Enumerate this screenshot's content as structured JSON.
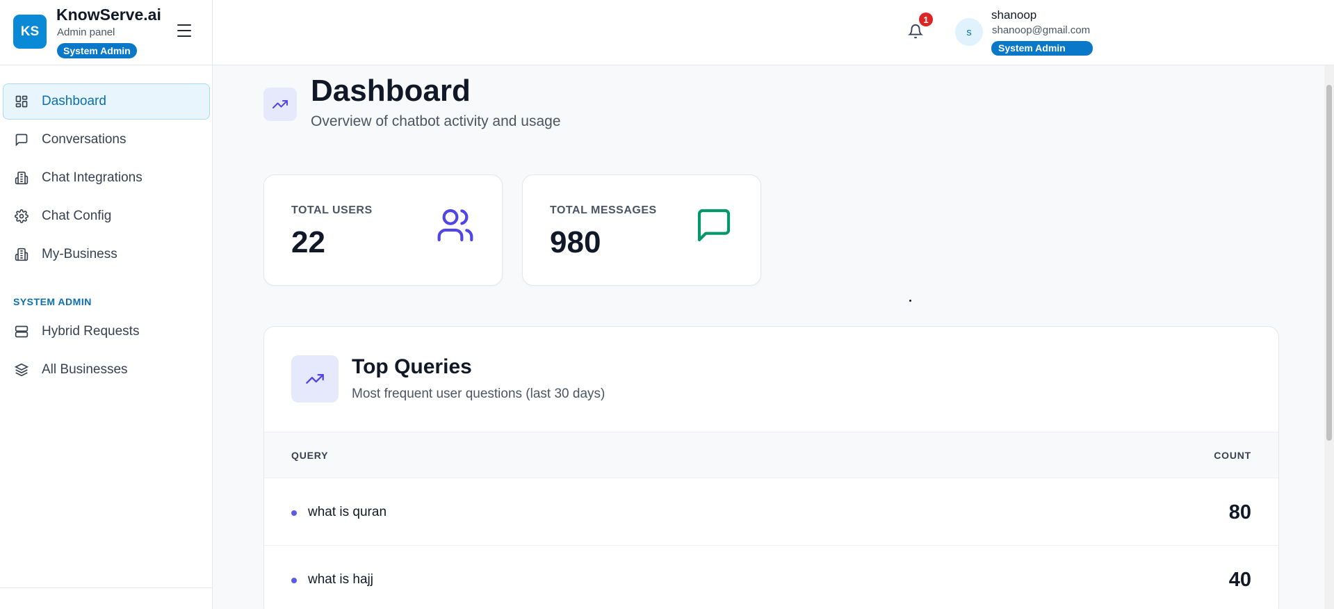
{
  "brand": {
    "logo_text": "KS",
    "name": "KnowServe.ai",
    "subtitle": "Admin panel",
    "badge": "System Admin"
  },
  "sidebar": {
    "items": [
      {
        "label": "Dashboard",
        "icon": "dashboard-grid-icon",
        "active": true
      },
      {
        "label": "Conversations",
        "icon": "message-square-icon"
      },
      {
        "label": "Chat Integrations",
        "icon": "building-icon"
      },
      {
        "label": "Chat Config",
        "icon": "gear-icon"
      },
      {
        "label": "My-Business",
        "icon": "building-icon"
      }
    ],
    "section_title": "SYSTEM ADMIN",
    "admin_items": [
      {
        "label": "Hybrid Requests",
        "icon": "server-icon"
      },
      {
        "label": "All Businesses",
        "icon": "layers-icon"
      }
    ]
  },
  "header": {
    "notification_count": "1",
    "user": {
      "avatar_initial": "s",
      "name": "shanoop",
      "email": "shanoop@gmail.com",
      "role_badge": "System Admin"
    }
  },
  "page": {
    "title": "Dashboard",
    "subtitle": "Overview of chatbot activity and usage",
    "icon": "trending-up-icon"
  },
  "stats": [
    {
      "label": "TOTAL USERS",
      "value": "22",
      "icon": "users-icon",
      "color": "#4f46e5"
    },
    {
      "label": "TOTAL MESSAGES",
      "value": "980",
      "icon": "message-square-icon",
      "color": "#059669"
    }
  ],
  "top_queries": {
    "title": "Top Queries",
    "subtitle": "Most frequent user questions (last 30 days)",
    "columns": [
      "QUERY",
      "COUNT"
    ],
    "rows": [
      {
        "query": "what is quran",
        "count": "80"
      },
      {
        "query": "what is hajj",
        "count": "40"
      }
    ]
  },
  "colors": {
    "accent": "#0a78c8",
    "brand_logo": "#0a8ad6",
    "active_nav_bg": "#e8f5fc",
    "bullet": "#5b5be6",
    "notification_badge": "#dc2626"
  }
}
